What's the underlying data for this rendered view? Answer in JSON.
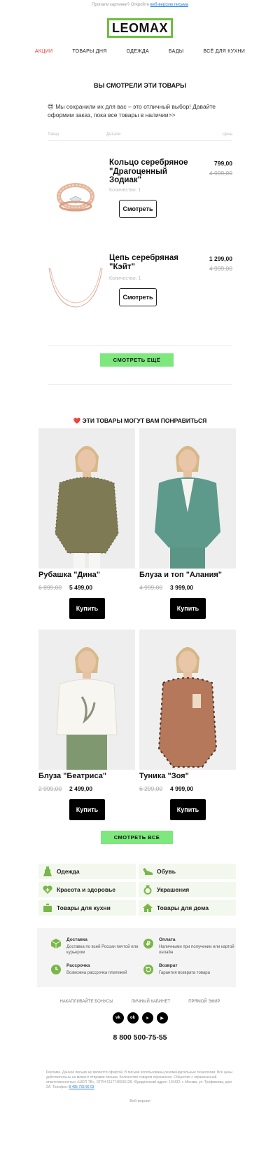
{
  "preheader": {
    "text": "Пропали картинки? Откройте ",
    "link": "веб-версию письма"
  },
  "brand": {
    "logo_text": "LEOMAX",
    "accent": "#6cbf3e"
  },
  "nav": [
    "АКЦИИ",
    "ТОВАРЫ ДНЯ",
    "ОДЕЖДА",
    "БАДЫ",
    "ВСЁ ДЛЯ КУХНИ"
  ],
  "viewed": {
    "title": "ВЫ СМОТРЕЛИ ЭТИ ТОВАРЫ",
    "intro": "😍 Мы сохранили их для вас – это отличный выбор! Давайте оформим заказ, пока все товары в наличии>>",
    "columns": [
      "Товар",
      "Детали",
      "Цена"
    ],
    "items": [
      {
        "name": "Кольцо серебряное \"Драгоценный Зодиак\"",
        "price": "799,00",
        "old_price": "4 999,00",
        "qty": "Количество: 1",
        "button": "Смотреть"
      },
      {
        "name": "Цепь серебряная \"Кэйт\"",
        "price": "1 299,00",
        "old_price": "4 999,00",
        "qty": "Количество: 1",
        "button": "Смотреть"
      }
    ],
    "more_button": "СМОТРЕТЬ ЕЩЁ"
  },
  "recommend": {
    "title": "❤️ ЭТИ ТОВАРЫ МОГУТ ВАМ ПОНРАВИТЬСЯ",
    "items": [
      {
        "name": "Рубашка \"Дина\"",
        "old_price": "6 899,00",
        "price": "5 499,00",
        "button": "Купить"
      },
      {
        "name": "Блуза и топ \"Алания\"",
        "old_price": "4 999,00",
        "price": "3 999,00",
        "button": "Купить"
      },
      {
        "name": "Блуза \"Беатриса\"",
        "old_price": "2 999,00",
        "price": "2 499,00",
        "button": "Купить"
      },
      {
        "name": "Туника \"Зоя\"",
        "old_price": "6 299,00",
        "price": "4 999,00",
        "button": "Купить"
      }
    ],
    "all_button": "СМОТРЕТЬ ВСЕ"
  },
  "categories": [
    {
      "label": "Одежда",
      "icon": "dress-icon"
    },
    {
      "label": "Обувь",
      "icon": "shoe-icon"
    },
    {
      "label": "Красота и здоровье",
      "icon": "heart-plus-icon"
    },
    {
      "label": "Украшения",
      "icon": "ring-icon"
    },
    {
      "label": "Товары для кухни",
      "icon": "pot-icon"
    },
    {
      "label": "Товары для дома",
      "icon": "house-icon"
    }
  ],
  "benefits": [
    {
      "title": "Доставка",
      "desc": "Доставка по всей России почтой или курьером",
      "icon": "box-icon"
    },
    {
      "title": "Оплата",
      "desc": "Наличными при получении или картой онлайн",
      "icon": "ruble-icon"
    },
    {
      "title": "Рассрочка",
      "desc": "Возможна рассрочка платежей",
      "icon": "clock-icon"
    },
    {
      "title": "Возврат",
      "desc": "Гарантия возврата товара",
      "icon": "return-icon"
    }
  ],
  "footer": {
    "links": [
      "НАКАПЛИВАЙТЕ БОНУСЫ",
      "ЛИЧНЫЙ КАБИНЕТ",
      "ПРЯМОЙ ЭФИР"
    ],
    "social": [
      "vk-icon",
      "ok-icon",
      "telegram-icon",
      "youtube-icon"
    ],
    "phone": "8 800 500-75-55",
    "legal": "Реклама. Данное письмо не является офертой. В письме использованы рекомендательные технологии. Все цены действительны на момент отправки письма. Количество товаров ограничено. Общество с ограниченной ответственностью «ШОП ТВ», ОГРН 5117746036128, Юридический адрес: 115432, г. Москва, ул. Трофимова, дом 2А. Телефон: ",
    "legal_phone": "8 495 733 96 03",
    "web_version": "Веб-версия"
  }
}
